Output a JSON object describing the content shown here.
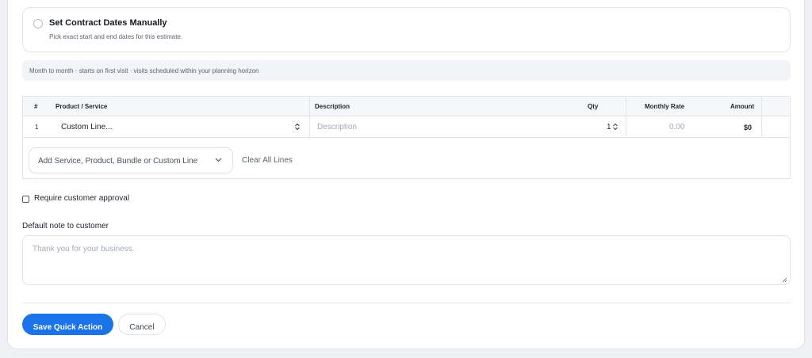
{
  "contract_option": {
    "title": "Set Contract Dates Manually",
    "subtitle": "Pick exact start and end dates for this estimate."
  },
  "info_bar": {
    "text": "Month to month · starts on first visit · visits scheduled within your planning horizon"
  },
  "line_table": {
    "headers": {
      "num": "#",
      "product": "Product / Service",
      "description": "Description",
      "qty": "Qty",
      "rate": "Monthly Rate",
      "amount": "Amount"
    },
    "rows": [
      {
        "num": "1",
        "product": "Custom Line...",
        "description_placeholder": "Description",
        "qty": "1",
        "rate_placeholder": "0.00",
        "amount": "$0"
      }
    ],
    "add_select_label": "Add Service, Product, Bundle or Custom Line",
    "clear_label": "Clear All Lines"
  },
  "approval": {
    "label": "Require customer approval",
    "checked": false
  },
  "note": {
    "label": "Default note to customer",
    "placeholder": "Thank you for your business."
  },
  "actions": {
    "save_label": "Save Quick Action",
    "cancel_label": "Cancel",
    "accent_color": "#1a73e8"
  },
  "icons": {
    "product_select": "updown-chevron-icon",
    "qty_stepper": "updown-chevron-icon",
    "add_select": "chevron-down-icon",
    "note_resize": "resize-handle-icon"
  }
}
